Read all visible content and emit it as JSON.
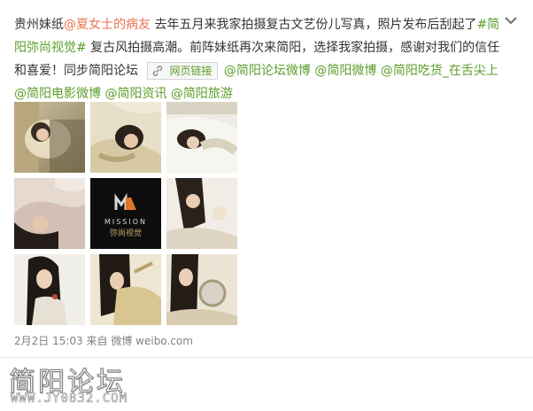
{
  "post": {
    "author_prefix": "贵州妹纸",
    "mention": "@夏女士的病友",
    "text_1": " 去年五月来我家拍摄复古文艺份儿写真，照片发布后刮起了",
    "hashtag": "#简阳弥尚视觉#",
    "text_2": " 复古风拍摄高潮。前阵妹纸再次来简阳，选择我家拍摄，感谢对我们的信任和喜爱！同步简阳论坛 ",
    "weblink_label": "网页链接",
    "mentions": [
      "@简阳论坛微博",
      "@简阳微博",
      "@简阳吃货_在舌尖上",
      "@简阳电影微博",
      "@简阳资讯",
      "@简阳旅游"
    ]
  },
  "images": [
    {
      "name": "photo-1",
      "tone": "warm-sepia"
    },
    {
      "name": "photo-2",
      "tone": "beige-bed"
    },
    {
      "name": "photo-3",
      "tone": "white-sheet"
    },
    {
      "name": "photo-4",
      "tone": "dark-hair-pink"
    },
    {
      "name": "photo-5",
      "tone": "logo",
      "logo_text": "MISSION",
      "logo_sub": "弥尚视觉"
    },
    {
      "name": "photo-6",
      "tone": "white-floral"
    },
    {
      "name": "photo-7",
      "tone": "white-portrait"
    },
    {
      "name": "photo-8",
      "tone": "yellow-wrap"
    },
    {
      "name": "photo-9",
      "tone": "mirror"
    }
  ],
  "meta": {
    "date": "2月2日 15:03",
    "from": "来自",
    "source": "微博 weibo.com"
  },
  "watermark": {
    "title": "简阳论坛",
    "url": "WWW.JY0832.COM"
  },
  "colors": {
    "mention": "#eb7350",
    "hashtag": "#5b9e29",
    "meta": "#808080"
  }
}
